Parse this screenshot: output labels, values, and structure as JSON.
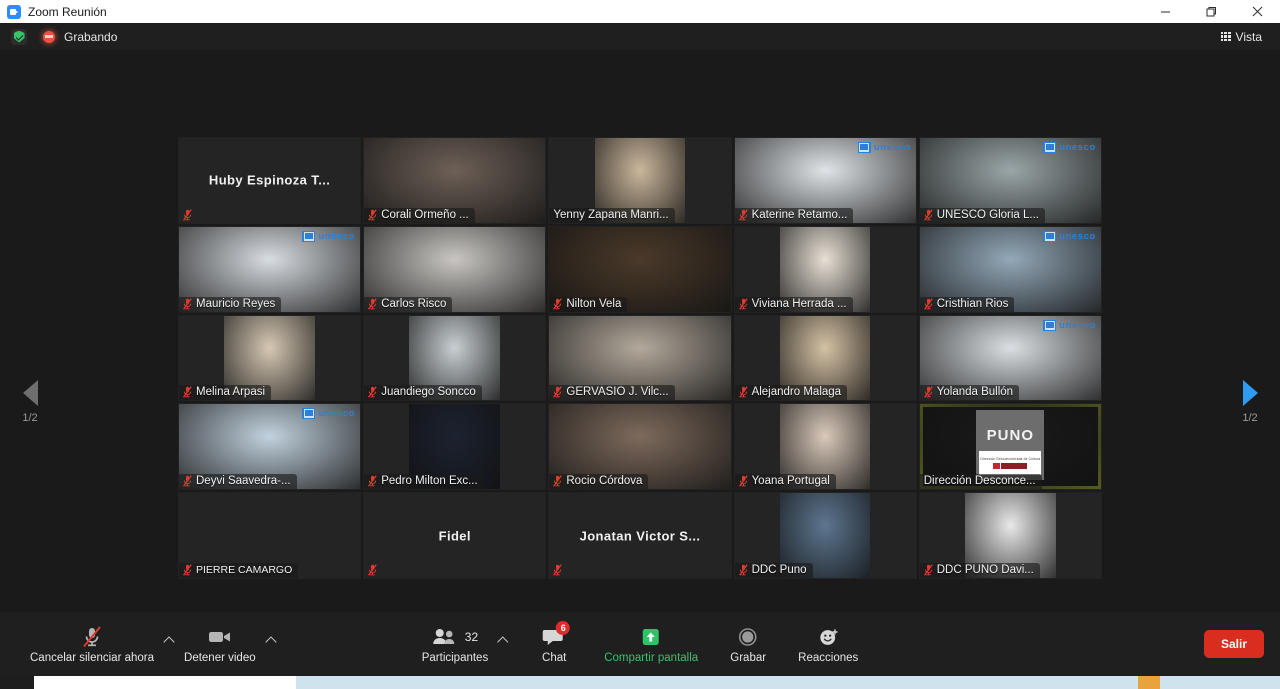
{
  "window": {
    "title": "Zoom Reunión",
    "app_icon": "zoom-camera-icon",
    "minimize": "–",
    "maximize": "▢",
    "close": "✕"
  },
  "topbar": {
    "shield_icon": "encryption-shield-icon",
    "recording_icon": "recording-dot-icon",
    "recording_label": "Grabando",
    "view_icon": "grid-view-icon",
    "view_label": "Vista"
  },
  "pager": {
    "prev_icon": "chevron-left-icon",
    "next_icon": "chevron-right-icon",
    "prev_page": "1/2",
    "next_page": "1/2",
    "prev_color": "#6e6e6e",
    "next_color": "#2f9cf4"
  },
  "grid": {
    "columns": 5,
    "rows": 5,
    "highlight_color": "#d6e83c",
    "unesco_brand_color": "#2f7fd4",
    "tiles": [
      {
        "name": "Huby Espinoza T...",
        "display": "center",
        "video": false,
        "muted": true,
        "unesco": false
      },
      {
        "name": "Corali Ormeño ...",
        "display": "bar",
        "video": true,
        "muted": true,
        "unesco": false,
        "crop": "full",
        "bg": "#6d6057"
      },
      {
        "name": "Yenny Zapana Manri...",
        "display": "bar",
        "video": true,
        "muted": false,
        "unesco": false,
        "crop": "narrow",
        "bg": "#cbb79c"
      },
      {
        "name": "Katerine Retamo...",
        "display": "bar",
        "video": true,
        "muted": true,
        "unesco": true,
        "crop": "full",
        "bg": "#dfe4e8"
      },
      {
        "name": "UNESCO Gloria L...",
        "display": "bar",
        "video": true,
        "muted": true,
        "unesco": true,
        "crop": "full",
        "bg": "#9aa6a8"
      },
      {
        "name": "Mauricio Reyes",
        "display": "bar",
        "video": true,
        "muted": true,
        "unesco": true,
        "crop": "full",
        "bg": "#d8dde2"
      },
      {
        "name": "Carlos Risco",
        "display": "bar",
        "video": true,
        "muted": true,
        "unesco": false,
        "crop": "full",
        "bg": "#c9c6c2"
      },
      {
        "name": "Nilton Vela",
        "display": "bar",
        "video": true,
        "muted": true,
        "unesco": false,
        "crop": "full",
        "bg": "#4a3a2a"
      },
      {
        "name": "Viviana Herrada ...",
        "display": "bar",
        "video": true,
        "muted": true,
        "unesco": false,
        "crop": "narrow",
        "bg": "#e8e0d5"
      },
      {
        "name": "Cristhian Rios",
        "display": "bar",
        "video": true,
        "muted": true,
        "unesco": true,
        "crop": "full",
        "bg": "#93a8b8"
      },
      {
        "name": "Melina Arpasi",
        "display": "bar",
        "video": true,
        "muted": true,
        "unesco": false,
        "crop": "narrow",
        "bg": "#d6c8b4"
      },
      {
        "name": "Juandiego Soncco",
        "display": "bar",
        "video": true,
        "muted": true,
        "unesco": false,
        "crop": "narrow",
        "bg": "#c8cfd2"
      },
      {
        "name": "GERVASIO J. Vilc...",
        "display": "bar",
        "video": true,
        "muted": true,
        "unesco": false,
        "crop": "full",
        "bg": "#b3a99c"
      },
      {
        "name": "Alejandro Malaga",
        "display": "bar",
        "video": true,
        "muted": true,
        "unesco": false,
        "crop": "narrow",
        "bg": "#d5c2a4"
      },
      {
        "name": "Yolanda Bullón",
        "display": "bar",
        "video": true,
        "muted": true,
        "unesco": true,
        "crop": "full",
        "bg": "#dadfe3"
      },
      {
        "name": "Deyvi Saavedra-...",
        "display": "bar",
        "video": true,
        "muted": true,
        "unesco": true,
        "crop": "full",
        "bg": "#c2d2de"
      },
      {
        "name": "Pedro Milton Exc...",
        "display": "bar",
        "video": true,
        "muted": true,
        "unesco": false,
        "crop": "narrow",
        "bg": "#1c2230"
      },
      {
        "name": "Rocio Córdova",
        "display": "bar",
        "video": true,
        "muted": true,
        "unesco": false,
        "crop": "full",
        "bg": "#7d6a5c"
      },
      {
        "name": "Yoana Portugal",
        "display": "bar",
        "video": true,
        "muted": true,
        "unesco": false,
        "crop": "narrow",
        "bg": "#d9c9ba"
      },
      {
        "name": "Dirección Desconce...",
        "display": "bar",
        "video": true,
        "muted": false,
        "unesco": false,
        "crop": "full",
        "bg": "#1a1a1a",
        "highlight": true,
        "share_card": {
          "title": "PUNO",
          "subtitle": "Dirección Desconcentrada de Cultura"
        }
      },
      {
        "name": "PIERRE CAMARGO",
        "display": "bar",
        "video": false,
        "muted": true,
        "unesco": false,
        "small": true
      },
      {
        "name": "Fidel",
        "display": "center",
        "video": false,
        "muted": true,
        "unesco": false
      },
      {
        "name": "Jonatan Victor S...",
        "display": "center",
        "video": false,
        "muted": true,
        "unesco": false
      },
      {
        "name": "DDC Puno",
        "display": "bar",
        "video": true,
        "muted": true,
        "unesco": false,
        "crop": "narrow",
        "bg": "#5d7690"
      },
      {
        "name": "DDC PUNO Davi...",
        "display": "bar",
        "video": true,
        "muted": true,
        "unesco": false,
        "crop": "narrow",
        "bg": "#e9e9e9"
      }
    ]
  },
  "toolbar": {
    "mute": {
      "icon": "microphone-muted-icon",
      "label": "Cancelar silenciar ahora"
    },
    "mute_caret": {
      "icon": "chevron-up-icon"
    },
    "video": {
      "icon": "camera-icon",
      "label": "Detener video"
    },
    "video_caret": {
      "icon": "chevron-up-icon"
    },
    "participants": {
      "icon": "participants-icon",
      "label": "Participantes",
      "count": "32"
    },
    "participants_caret": {
      "icon": "chevron-up-icon"
    },
    "chat": {
      "icon": "chat-bubble-icon",
      "label": "Chat",
      "badge": "6"
    },
    "share": {
      "icon": "share-screen-icon",
      "label": "Compartir pantalla",
      "color": "#39c06c"
    },
    "record": {
      "icon": "record-circle-icon",
      "label": "Grabar"
    },
    "reactions": {
      "icon": "reactions-smiley-icon",
      "label": "Reacciones"
    },
    "leave": {
      "label": "Salir",
      "color": "#d92d20"
    }
  }
}
